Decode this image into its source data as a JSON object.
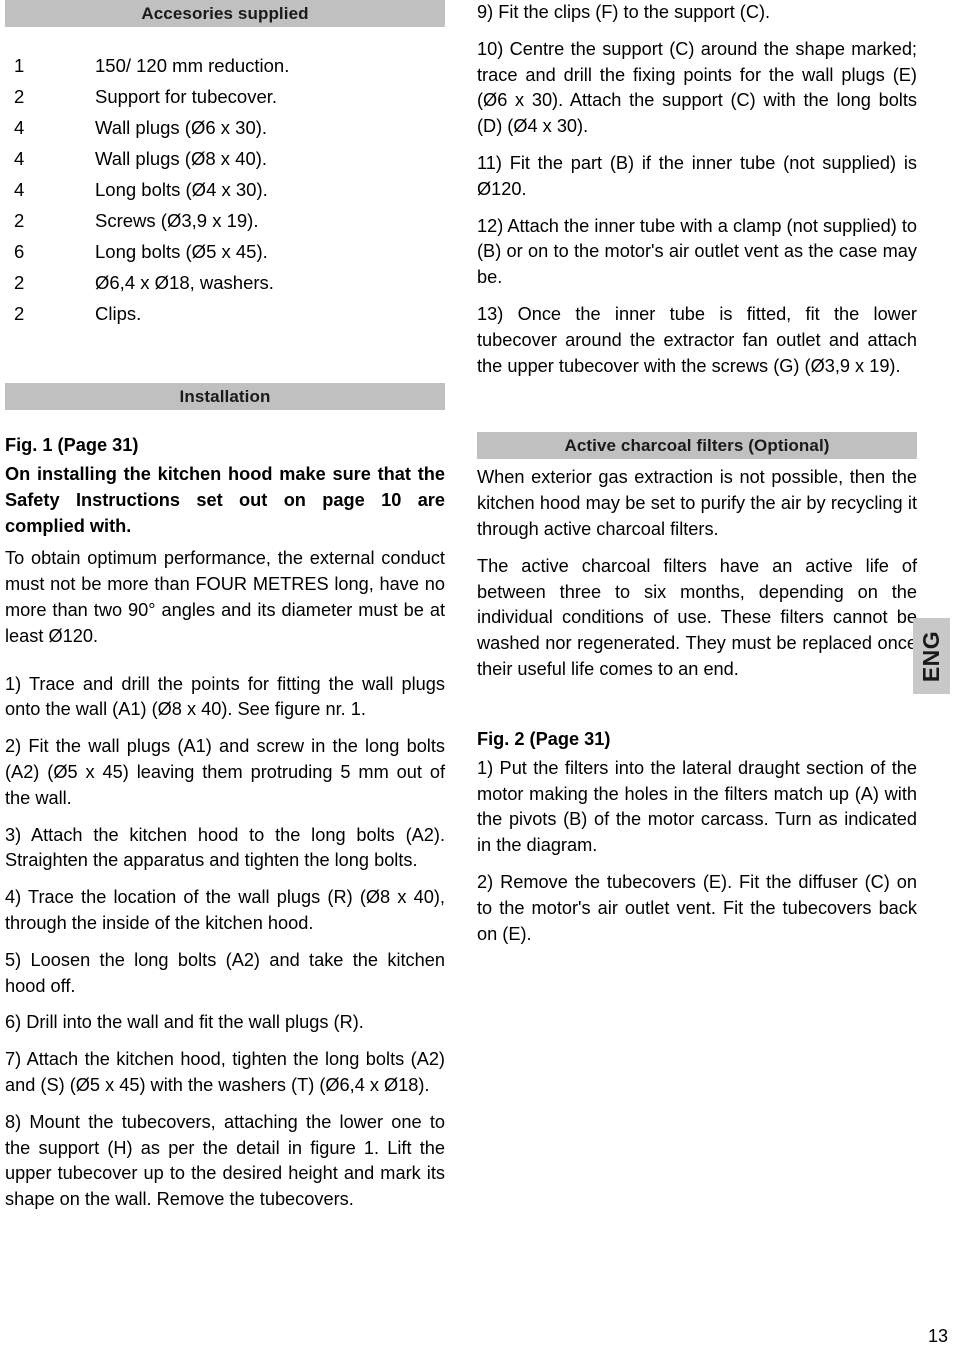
{
  "page": {
    "number": "13",
    "language_tab": "ENG"
  },
  "left_column": {
    "accessories_heading": "Accesories supplied",
    "accessories": [
      {
        "qty": "1",
        "description": "150/ 120 mm reduction."
      },
      {
        "qty": "2",
        "description": "Support for tubecover."
      },
      {
        "qty": "4",
        "description": "Wall plugs (Ø6 x 30)."
      },
      {
        "qty": "4",
        "description": "Wall plugs (Ø8 x 40)."
      },
      {
        "qty": "4",
        "description": "Long bolts (Ø4 x 30)."
      },
      {
        "qty": "2",
        "description": "Screws (Ø3,9 x 19)."
      },
      {
        "qty": "6",
        "description": "Long bolts (Ø5 x 45)."
      },
      {
        "qty": "2",
        "description": "Ø6,4 x Ø18, washers."
      },
      {
        "qty": "2",
        "description": "Clips."
      }
    ],
    "installation_heading": "Installation",
    "fig1_heading": "Fig. 1 (Page 31)",
    "safety_note": "On installing the kitchen hood make sure that the Safety Instructions set out on page 10 are complied with.",
    "performance_note": "To obtain optimum performance, the external conduct must not be more than FOUR METRES long, have no more than two 90° angles and its diameter must be at least Ø120.",
    "steps": [
      "1) Trace and drill the points for fitting the wall plugs onto the wall (A1) (Ø8 x 40). See figure nr. 1.",
      "2) Fit the wall plugs (A1) and screw in the long bolts (A2) (Ø5 x 45) leaving them protruding 5 mm out of the wall.",
      "3) Attach the kitchen hood to the long bolts (A2). Straighten the apparatus and tighten the long bolts.",
      "4) Trace the location of the wall plugs (R) (Ø8 x 40), through the inside of the kitchen hood.",
      "5) Loosen the long bolts (A2) and take the kitchen hood off.",
      "6) Drill into the wall and fit the wall plugs (R).",
      "7) Attach the kitchen hood, tighten the long bolts (A2) and (S) (Ø5 x 45) with the washers (T) (Ø6,4 x Ø18).",
      "8) Mount the tubecovers, attaching the lower one to the support (H) as per the detail in figure 1. Lift the upper tubecover up to the desired height and mark its shape on the wall. Remove the tubecovers."
    ]
  },
  "right_column": {
    "steps_continued": [
      "9) Fit the clips (F) to the support (C).",
      "10) Centre the support (C) around the shape marked; trace and drill the fixing points for the wall plugs (E) (Ø6 x 30). Attach the support (C) with the long bolts (D) (Ø4 x 30).",
      "11) Fit the part (B) if the inner tube (not supplied) is Ø120.",
      "12) Attach the inner tube with a clamp (not supplied) to (B) or on to the motor's air outlet vent as the case may be.",
      "13) Once the inner tube is fitted, fit the lower tubecover around the extractor fan outlet and attach the upper tubecover with the screws (G) (Ø3,9 x 19)."
    ],
    "charcoal_heading": "Active charcoal filters  (Optional)",
    "charcoal_paragraphs": [
      "When exterior gas extraction is not possible, then the kitchen hood may be set to purify the air by recycling it through active charcoal filters.",
      "The active charcoal filters have an active life of between three to six  months, depending on the individual  conditions of use. These filters cannot be washed nor regenerated. They must be replaced once their useful life comes to an end."
    ],
    "fig2_heading": "Fig.  2 (Page 31)",
    "fig2_steps": [
      "1) Put the filters into the lateral draught section of the motor making the holes in the filters match up (A) with the pivots (B) of the motor carcass. Turn as indicated in the diagram.",
      "2) Remove the tubecovers (E). Fit the diffuser (C) on to the motor's air outlet vent. Fit the tubecovers back on (E)."
    ]
  },
  "colors": {
    "heading_bar": "#c0c0c0",
    "lang_tab": "#c8c8c8",
    "text": "#000000"
  }
}
